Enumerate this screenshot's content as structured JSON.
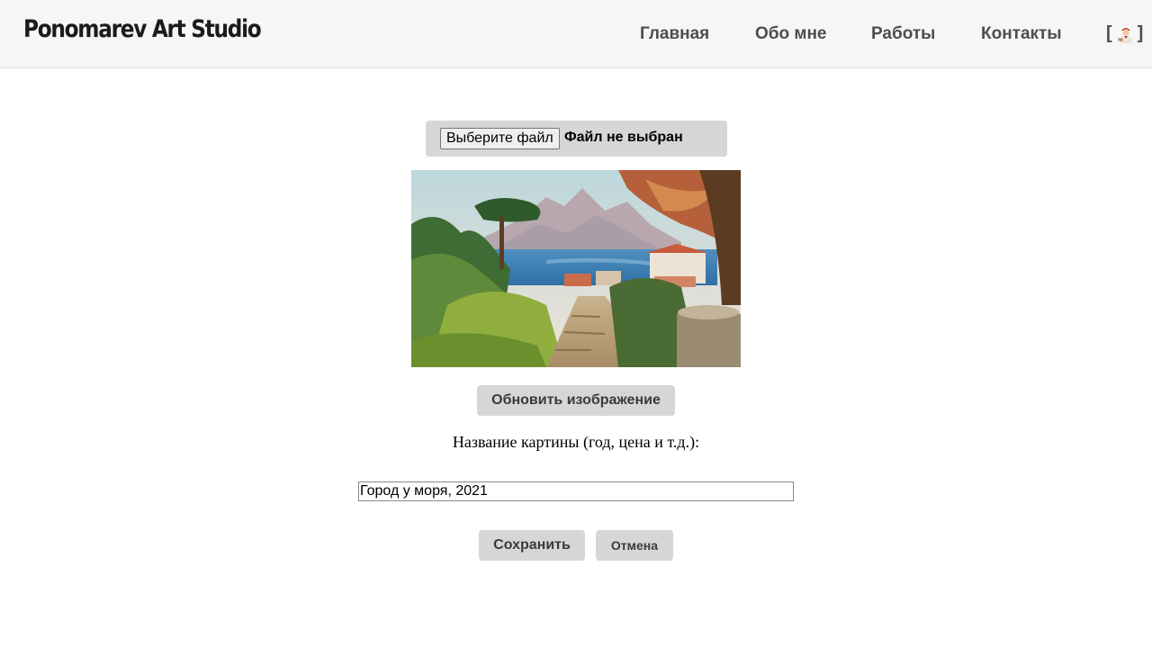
{
  "header": {
    "logo": "Ponomarev Art Studio",
    "nav": {
      "home": "Главная",
      "about": "Обо мне",
      "works": "Работы",
      "contacts": "Контакты"
    },
    "admin": {
      "open_bracket": "[",
      "close_bracket": "]",
      "icon": "artist-avatar-icon"
    }
  },
  "editor": {
    "file_button": "Выберите файл",
    "file_status": "Файл не выбран",
    "painting_icon": "landscape-painting",
    "update_button": "Обновить изображение",
    "title_label": "Название картины (год, цена и т.д.):",
    "title_value": "Город у моря, 2021",
    "save_button": "Сохранить",
    "cancel_button": "Отмена"
  },
  "colors": {
    "header_bg": "#f6f6f6",
    "button_bg": "#d6d6d6",
    "nav_text": "#4d4d4d",
    "logo_text": "#1b1b1b"
  }
}
